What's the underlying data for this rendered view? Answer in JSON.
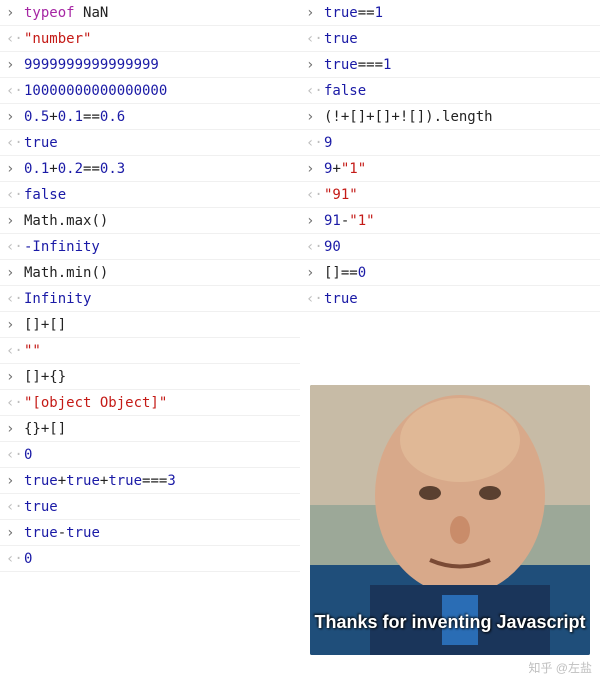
{
  "markers": {
    "in": "›",
    "out": "‹·"
  },
  "left": [
    {
      "t": "in",
      "segs": [
        [
          "kw",
          "typeof "
        ],
        [
          "id",
          "NaN"
        ]
      ]
    },
    {
      "t": "out",
      "segs": [
        [
          "str",
          "\"number\""
        ]
      ]
    },
    {
      "t": "in",
      "segs": [
        [
          "num",
          "9999999999999999"
        ]
      ]
    },
    {
      "t": "out",
      "segs": [
        [
          "num",
          "10000000000000000"
        ]
      ]
    },
    {
      "t": "in",
      "segs": [
        [
          "num",
          "0.5"
        ],
        [
          "op",
          "+"
        ],
        [
          "num",
          "0.1"
        ],
        [
          "op",
          "=="
        ],
        [
          "num",
          "0.6"
        ]
      ]
    },
    {
      "t": "out",
      "segs": [
        [
          "bool",
          "true"
        ]
      ]
    },
    {
      "t": "in",
      "segs": [
        [
          "num",
          "0.1"
        ],
        [
          "op",
          "+"
        ],
        [
          "num",
          "0.2"
        ],
        [
          "op",
          "=="
        ],
        [
          "num",
          "0.3"
        ]
      ]
    },
    {
      "t": "out",
      "segs": [
        [
          "bool",
          "false"
        ]
      ]
    },
    {
      "t": "in",
      "segs": [
        [
          "id",
          "Math"
        ],
        [
          "op",
          "."
        ],
        [
          "id",
          "max"
        ],
        [
          "op",
          "()"
        ]
      ]
    },
    {
      "t": "out",
      "segs": [
        [
          "num",
          "-Infinity"
        ]
      ]
    },
    {
      "t": "in",
      "segs": [
        [
          "id",
          "Math"
        ],
        [
          "op",
          "."
        ],
        [
          "id",
          "min"
        ],
        [
          "op",
          "()"
        ]
      ]
    },
    {
      "t": "out",
      "segs": [
        [
          "num",
          "Infinity"
        ]
      ]
    },
    {
      "t": "in",
      "segs": [
        [
          "op",
          "[]+[]"
        ]
      ]
    },
    {
      "t": "out",
      "segs": [
        [
          "str",
          "\"\""
        ]
      ]
    },
    {
      "t": "in",
      "segs": [
        [
          "op",
          "[]+{}"
        ]
      ]
    },
    {
      "t": "out",
      "segs": [
        [
          "str",
          "\"[object Object]\""
        ]
      ]
    },
    {
      "t": "in",
      "segs": [
        [
          "op",
          "{}+[]"
        ]
      ]
    },
    {
      "t": "out",
      "segs": [
        [
          "num",
          "0"
        ]
      ]
    },
    {
      "t": "in",
      "segs": [
        [
          "bool",
          "true"
        ],
        [
          "op",
          "+"
        ],
        [
          "bool",
          "true"
        ],
        [
          "op",
          "+"
        ],
        [
          "bool",
          "true"
        ],
        [
          "op",
          "==="
        ],
        [
          "num",
          "3"
        ]
      ]
    },
    {
      "t": "out",
      "segs": [
        [
          "bool",
          "true"
        ]
      ]
    },
    {
      "t": "in",
      "segs": [
        [
          "bool",
          "true"
        ],
        [
          "op",
          "-"
        ],
        [
          "bool",
          "true"
        ]
      ]
    },
    {
      "t": "out",
      "segs": [
        [
          "num",
          "0"
        ]
      ]
    }
  ],
  "right": [
    {
      "t": "in",
      "segs": [
        [
          "bool",
          "true"
        ],
        [
          "op",
          "=="
        ],
        [
          "num",
          "1"
        ]
      ]
    },
    {
      "t": "out",
      "segs": [
        [
          "bool",
          "true"
        ]
      ]
    },
    {
      "t": "in",
      "segs": [
        [
          "bool",
          "true"
        ],
        [
          "op",
          "==="
        ],
        [
          "num",
          "1"
        ]
      ]
    },
    {
      "t": "out",
      "segs": [
        [
          "bool",
          "false"
        ]
      ]
    },
    {
      "t": "in",
      "segs": [
        [
          "op",
          "(!+[]+[]+![])."
        ],
        [
          "id",
          "length"
        ]
      ]
    },
    {
      "t": "out",
      "segs": [
        [
          "num",
          "9"
        ]
      ]
    },
    {
      "t": "in",
      "segs": [
        [
          "num",
          "9"
        ],
        [
          "op",
          "+"
        ],
        [
          "str",
          "\"1\""
        ]
      ]
    },
    {
      "t": "out",
      "segs": [
        [
          "str",
          "\"91\""
        ]
      ]
    },
    {
      "t": "in",
      "segs": [
        [
          "num",
          "91"
        ],
        [
          "op",
          "-"
        ],
        [
          "str",
          "\"1\""
        ]
      ]
    },
    {
      "t": "out",
      "segs": [
        [
          "num",
          "90"
        ]
      ]
    },
    {
      "t": "in",
      "segs": [
        [
          "op",
          "[]=="
        ],
        [
          "num",
          "0"
        ]
      ]
    },
    {
      "t": "out",
      "segs": [
        [
          "bool",
          "true"
        ]
      ]
    }
  ],
  "photo_caption": "Thanks for inventing Javascript",
  "watermark": "知乎 @左盐"
}
